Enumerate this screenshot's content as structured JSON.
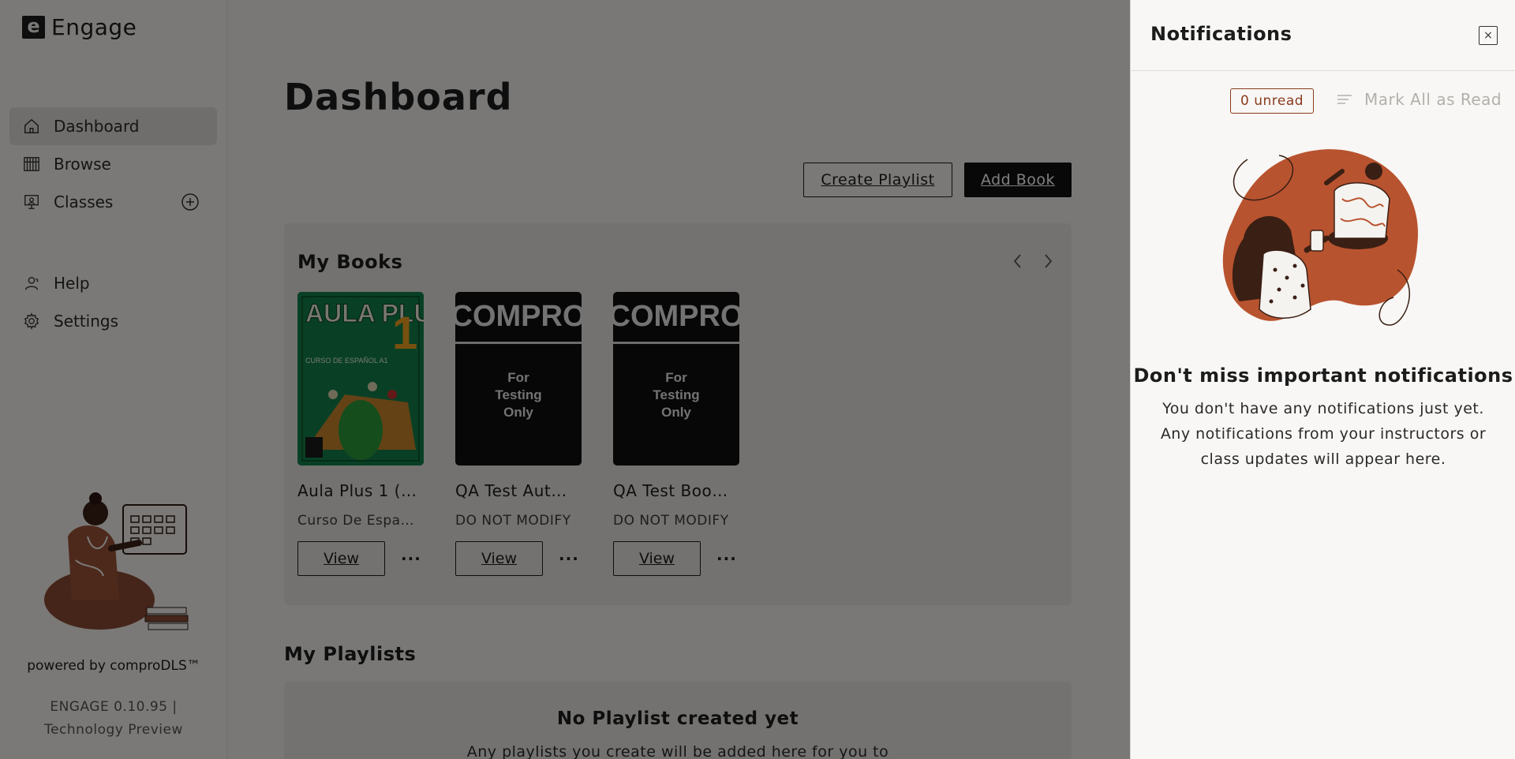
{
  "app": {
    "logo_letter": "e",
    "name": "Engage"
  },
  "sidebar": {
    "items": [
      {
        "label": "Dashboard",
        "icon": "home-icon"
      },
      {
        "label": "Browse",
        "icon": "library-icon"
      },
      {
        "label": "Classes",
        "icon": "classes-icon"
      }
    ],
    "secondary": [
      {
        "label": "Help",
        "icon": "help-icon"
      },
      {
        "label": "Settings",
        "icon": "gear-icon"
      }
    ],
    "powered_by": "powered by comproDLS™",
    "version_line1": "ENGAGE 0.10.95 |",
    "version_line2": "Technology Preview"
  },
  "main": {
    "title": "Dashboard",
    "create_playlist": "Create Playlist",
    "add_book": "Add Book",
    "my_books_title": "My Books",
    "books": [
      {
        "title": "Aula Plus 1 (…",
        "subtitle": "Curso De Espa…",
        "view": "View",
        "more": "···",
        "cover_title": "AULA PLUS",
        "cover_number": "1",
        "cover_sub": "CURSO DE ESPAÑOL A1"
      },
      {
        "title": "QA Test Aut…",
        "subtitle": "DO NOT MODIFY",
        "view": "View",
        "more": "···",
        "cover_title": "COMPRO",
        "cover_lines": [
          "For",
          "Testing",
          "Only"
        ]
      },
      {
        "title": "QA Test Boo…",
        "subtitle": "DO NOT MODIFY",
        "view": "View",
        "more": "···",
        "cover_title": "COMPRO",
        "cover_lines": [
          "For",
          "Testing",
          "Only"
        ]
      }
    ],
    "my_playlists_title": "My Playlists",
    "playlist_empty_title": "No Playlist created yet",
    "playlist_empty_text": "Any playlists you create will be added here for you to"
  },
  "notifications": {
    "title": "Notifications",
    "close": "×",
    "unread": "0 unread",
    "mark_all": "Mark All as Read",
    "empty_title": "Don't miss important notifications",
    "empty_text": "You don't have any notifications just yet. Any notifications from your instructors or class updates will appear here."
  },
  "colors": {
    "accent": "#b8532f",
    "dark": "#1c1c1c",
    "overlay": "rgba(0,0,0,0.5)"
  }
}
